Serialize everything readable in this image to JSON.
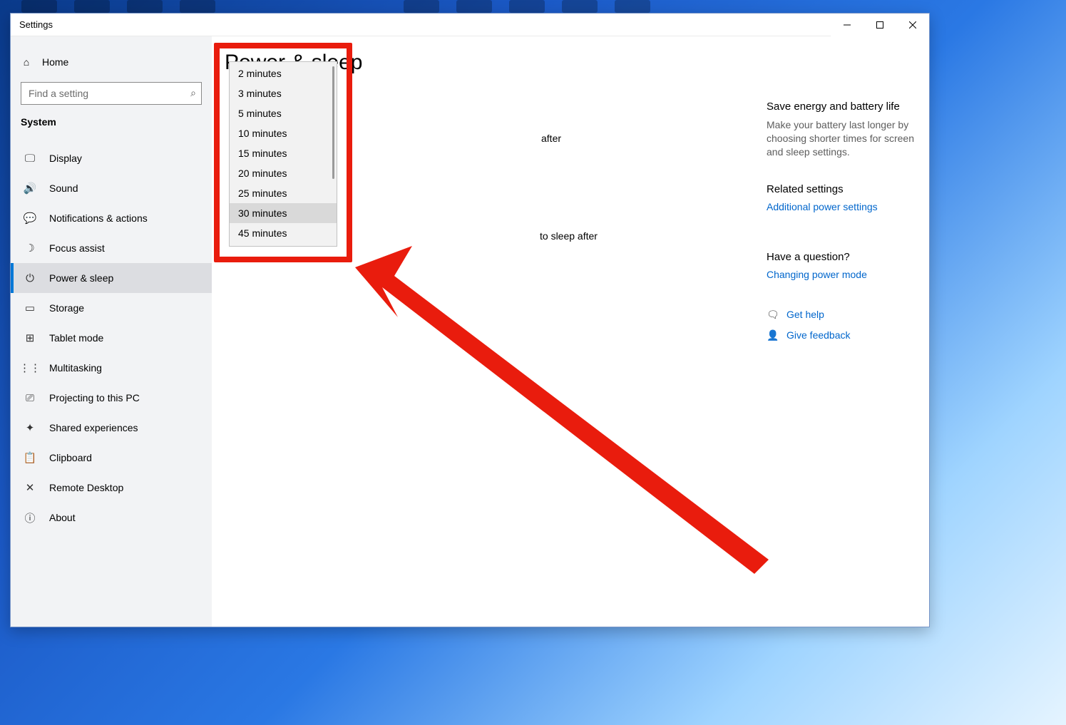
{
  "window": {
    "title": "Settings"
  },
  "search": {
    "placeholder": "Find a setting"
  },
  "sidebar": {
    "home": "Home",
    "section": "System",
    "items": [
      {
        "label": "Display",
        "icon": "🖵"
      },
      {
        "label": "Sound",
        "icon": "🔊"
      },
      {
        "label": "Notifications & actions",
        "icon": "💬"
      },
      {
        "label": "Focus assist",
        "icon": "☽"
      },
      {
        "label": "Power & sleep",
        "icon": "⏻"
      },
      {
        "label": "Storage",
        "icon": "▭"
      },
      {
        "label": "Tablet mode",
        "icon": "⊞"
      },
      {
        "label": "Multitasking",
        "icon": "⋮⋮"
      },
      {
        "label": "Projecting to this PC",
        "icon": "⎚"
      },
      {
        "label": "Shared experiences",
        "icon": "✦"
      },
      {
        "label": "Clipboard",
        "icon": "📋"
      },
      {
        "label": "Remote Desktop",
        "icon": "✕"
      },
      {
        "label": "About",
        "icon": "ⓘ"
      }
    ],
    "active_index": 4
  },
  "main": {
    "title": "Power & sleep",
    "screen_text_fragment": "after",
    "sleep_text_fragment": "to sleep after",
    "dropdown_options": [
      "2 minutes",
      "3 minutes",
      "5 minutes",
      "10 minutes",
      "15 minutes",
      "20 minutes",
      "25 minutes",
      "30 minutes",
      "45 minutes"
    ],
    "selected_option": "30 minutes"
  },
  "rightside": {
    "energy_head": "Save energy and battery life",
    "energy_text": "Make your battery last longer by choosing shorter times for screen and sleep settings.",
    "related_head": "Related settings",
    "related_link": "Additional power settings",
    "question_head": "Have a question?",
    "question_link": "Changing power mode",
    "help_link": "Get help",
    "feedback_link": "Give feedback"
  }
}
